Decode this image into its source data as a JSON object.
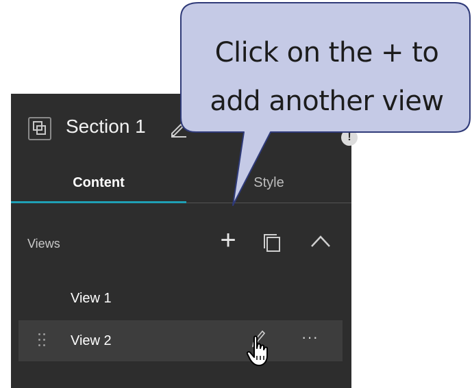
{
  "section": {
    "title": "Section 1",
    "icon": "section-frame-icon",
    "edit_icon": "pencil-icon",
    "info_icon": "info-icon"
  },
  "tabs": [
    {
      "label": "Content",
      "active": true
    },
    {
      "label": "Style",
      "active": false
    }
  ],
  "views": {
    "label": "Views",
    "actions": [
      {
        "name": "add-view-button",
        "glyph": "+",
        "icon": "plus-icon"
      },
      {
        "name": "duplicate-view-button",
        "icon": "duplicate-icon"
      },
      {
        "name": "collapse-views-button",
        "icon": "chevron-up-icon"
      }
    ],
    "items": [
      {
        "label": "View 1",
        "selected": false
      },
      {
        "label": "View 2",
        "selected": true
      }
    ]
  },
  "row_actions": {
    "more": "···"
  },
  "callout": {
    "line1": "Click on the + to",
    "line2": "add another view"
  },
  "colors": {
    "panel_bg": "#2d2d2d",
    "selected_row_bg": "#3d3d3d",
    "accent_underline": "#1fa0b5",
    "callout_fill": "#c5cae6",
    "callout_stroke": "#2f3a78"
  }
}
